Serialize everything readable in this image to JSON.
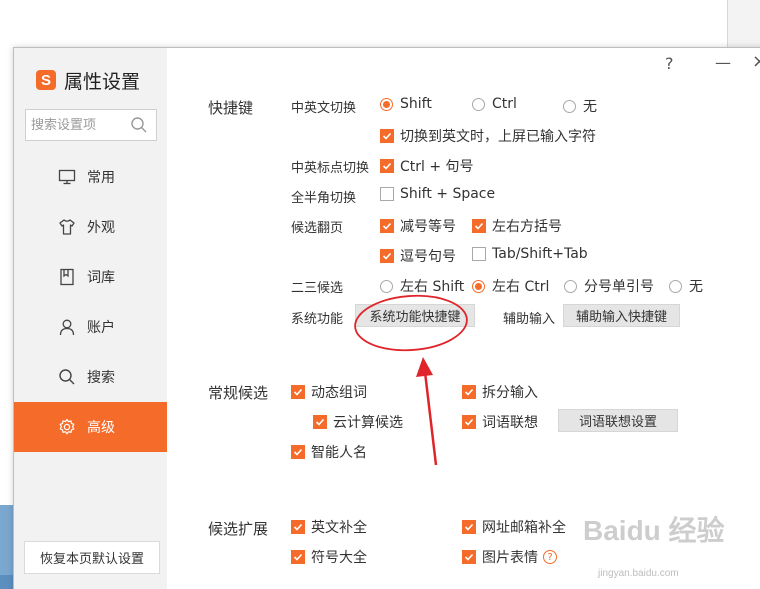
{
  "window": {
    "title": "属性设置",
    "logo": "S",
    "help": "?",
    "minimize": "—",
    "close": "×"
  },
  "sidebar": {
    "search_placeholder": "搜索设置项",
    "items": [
      {
        "label": "常用",
        "icon": "monitor-icon"
      },
      {
        "label": "外观",
        "icon": "shirt-icon"
      },
      {
        "label": "词库",
        "icon": "book-icon"
      },
      {
        "label": "账户",
        "icon": "user-icon"
      },
      {
        "label": "搜索",
        "icon": "search-icon"
      },
      {
        "label": "高级",
        "icon": "gear-icon"
      }
    ],
    "active": "高级",
    "reset_label": "恢复本页默认设置"
  },
  "shortcuts": {
    "title": "快捷键",
    "cn_en_label": "中英文切换",
    "cn_en_options": [
      "Shift",
      "Ctrl",
      "无"
    ],
    "cn_en_selected": "Shift",
    "commit_label": "切换到英文时，上屏已输入字符",
    "punct_label": "中英标点切换",
    "punct_value": "Ctrl + 句号",
    "width_label": "全半角切换",
    "width_value": "Shift + Space",
    "page_label": "候选翻页",
    "page_opts": [
      "减号等号",
      "左右方括号",
      "逗号句号",
      "Tab/Shift+Tab"
    ],
    "second_label": "二三候选",
    "second_opts": [
      "左右 Shift",
      "左右 Ctrl",
      "分号单引号",
      "无"
    ],
    "second_selected": "左右 Ctrl",
    "sys_label": "系统功能",
    "sys_btn": "系统功能快捷键",
    "aux_label": "辅助输入",
    "aux_btn": "辅助输入快捷键"
  },
  "candidates": {
    "title": "常规候选",
    "dynamic": "动态组词",
    "cloud": "云计算候选",
    "names": "智能人名",
    "split": "拆分输入",
    "assoc": "词语联想",
    "assoc_btn": "词语联想设置"
  },
  "extension": {
    "title": "候选扩展",
    "english": "英文补全",
    "web": "网址邮箱补全",
    "symbols": "符号大全",
    "emoji": "图片表情",
    "emoji_help": "?"
  },
  "watermark": {
    "text": "Baidu 经验",
    "sub": "jingyan.baidu.com"
  },
  "colors": {
    "accent": "#f56b2a",
    "annotation": "#e0252a"
  }
}
